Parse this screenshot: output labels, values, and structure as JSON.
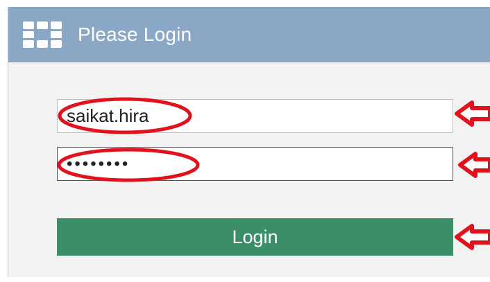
{
  "header": {
    "title": "Please Login",
    "logo_icon": "fortinet-grid-icon",
    "background_color": "#8aa8c6"
  },
  "form": {
    "username": {
      "value": "saikat.hira"
    },
    "password": {
      "value": "********"
    },
    "login_button": {
      "label": "Login",
      "color": "#3c8e68"
    }
  },
  "annotations": {
    "highlight_color": "#e1121c",
    "ellipse_icon": "highlight-ellipse-icon",
    "arrow_icon": "arrow-left-icon"
  }
}
